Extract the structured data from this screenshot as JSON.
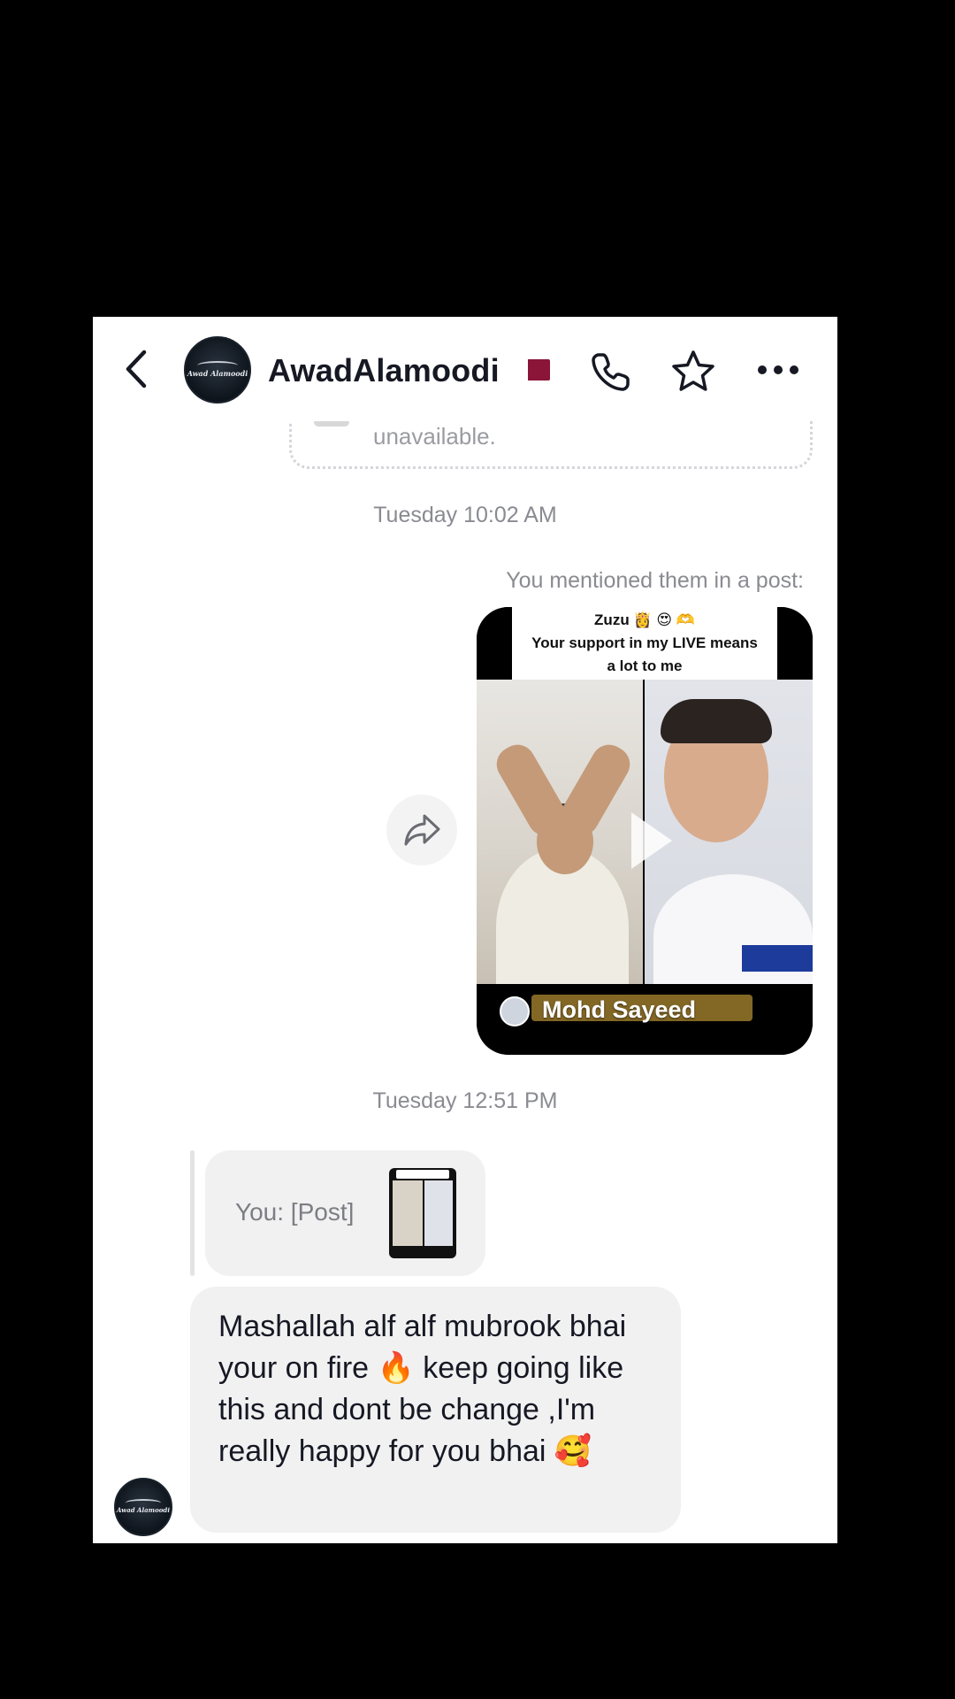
{
  "header": {
    "user_name": "AwadAlamoodi",
    "avatar_logo_text": "Awad Alamoodi",
    "icons": {
      "back": "chevron-left-icon",
      "call": "phone-icon",
      "favorite": "star-icon",
      "more": "more-horizontal-icon"
    }
  },
  "thread": {
    "unavailable_text": "unavailable.",
    "timestamp_1": "Tuesday 10:02 AM",
    "mention_caption": "You mentioned them in a post:",
    "video_card": {
      "caption_line1": "Zuzu 👸 😍 🫶",
      "caption_line2": "Your support in my LIVE means",
      "caption_line3": "a lot to me",
      "handle": "Mohd Sayeed"
    },
    "timestamp_2": "Tuesday 12:51 PM",
    "reply_preview": "You: [Post]",
    "message_text": "Mashallah alf alf mubrook bhai your on fire 🔥 keep going like this and dont be change ,I'm really happy  for you bhai 🥰"
  },
  "colors": {
    "background": "#000000",
    "screen": "#ffffff",
    "bubble": "#f1f1f2",
    "text_primary": "#161823",
    "text_secondary": "#8a8b91"
  }
}
